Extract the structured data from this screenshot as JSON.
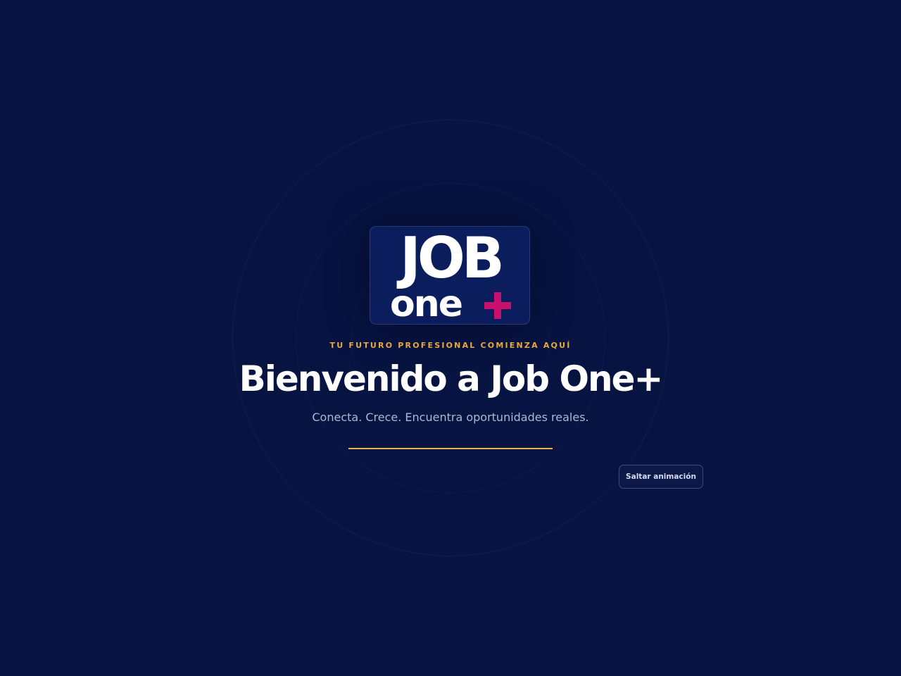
{
  "logo": {
    "line1": "JOB",
    "line2": "one",
    "plus_color": "#c8106c"
  },
  "tagline": "TU FUTURO PROFESIONAL COMIENZA AQUÍ",
  "title": "Bienvenido a Job One+",
  "subtitle": "Conecta. Crece. Encuentra oportunidades reales.",
  "progress": {
    "fraction": 1.0,
    "color": "#e9b54a"
  },
  "skip_button": {
    "label": "Saltar animación"
  },
  "colors": {
    "background": "#071341",
    "accent": "#e9a93a",
    "brand_plus": "#c8106c"
  }
}
